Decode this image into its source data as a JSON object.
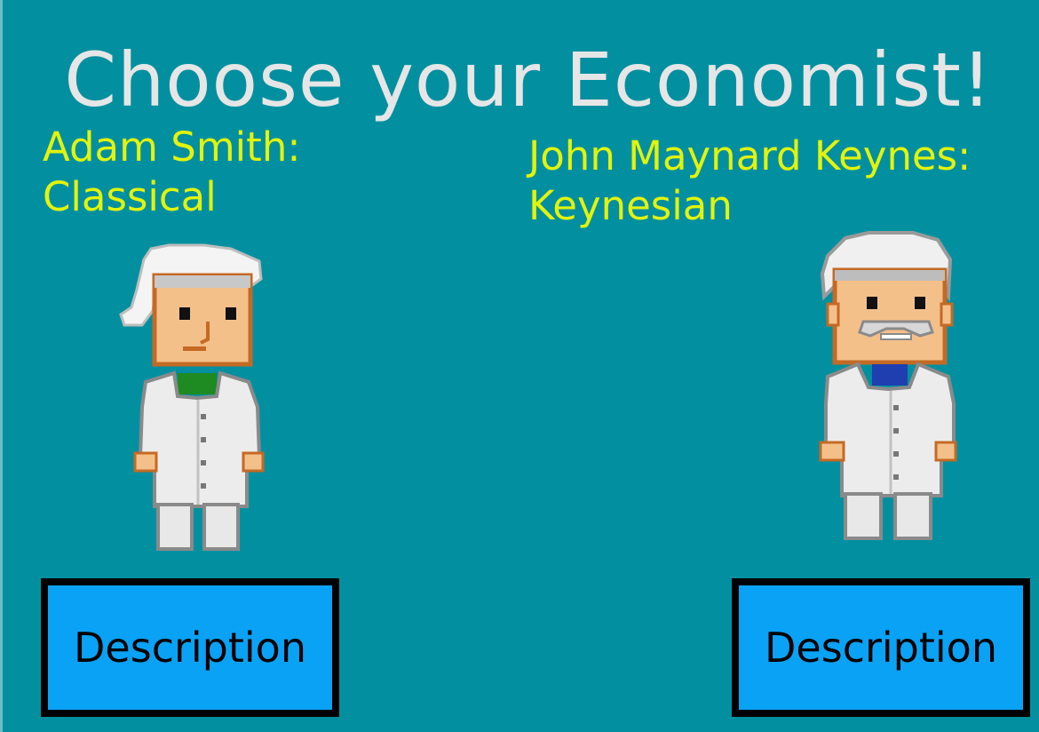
{
  "screen": {
    "title": "Choose your Economist!"
  },
  "economists": [
    {
      "name": "Adam Smith:",
      "school": "Classical",
      "button_label": "Description",
      "sprite": "adam-smith-sprite",
      "shirt_color": "#1e8a22"
    },
    {
      "name": "John Maynard Keynes:",
      "school": "Keynesian",
      "button_label": "Description",
      "sprite": "keynes-sprite",
      "shirt_color": "#1f3fb0"
    }
  ],
  "colors": {
    "background": "#0290a0",
    "title": "#e6e6e6",
    "name_text": "#e2f30c",
    "button_fill": "#0aa2f5",
    "button_border": "#000000"
  }
}
